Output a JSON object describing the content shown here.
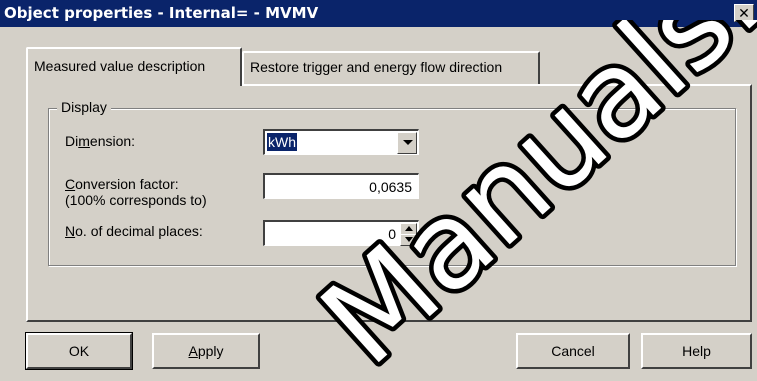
{
  "window": {
    "title": "Object properties - Internal= - MVMV",
    "close_glyph": "✕"
  },
  "tabs": [
    {
      "label": "Measured value description",
      "active": true
    },
    {
      "label": "Restore trigger and energy flow direction",
      "active": false
    }
  ],
  "group": {
    "title": "Display"
  },
  "fields": {
    "dimension": {
      "label_pre": "Di",
      "label_ul": "m",
      "label_post": "ension:",
      "value": "kWh"
    },
    "conversion_factor": {
      "label_ul": "C",
      "label_post": "onversion factor:",
      "label_line2": "(100% corresponds to)",
      "value": "0,0635"
    },
    "decimal_places": {
      "label_ul": "N",
      "label_post": "o. of decimal places:",
      "value": "0"
    }
  },
  "buttons": {
    "ok": "OK",
    "apply_ul": "A",
    "apply_post": "pply",
    "cancel": "Cancel",
    "help": "Help"
  },
  "watermark": {
    "text": "ManualsLib"
  },
  "colors": {
    "titlebar": "#0a246a",
    "face": "#d4d0c8",
    "selection": "#0a246a"
  }
}
